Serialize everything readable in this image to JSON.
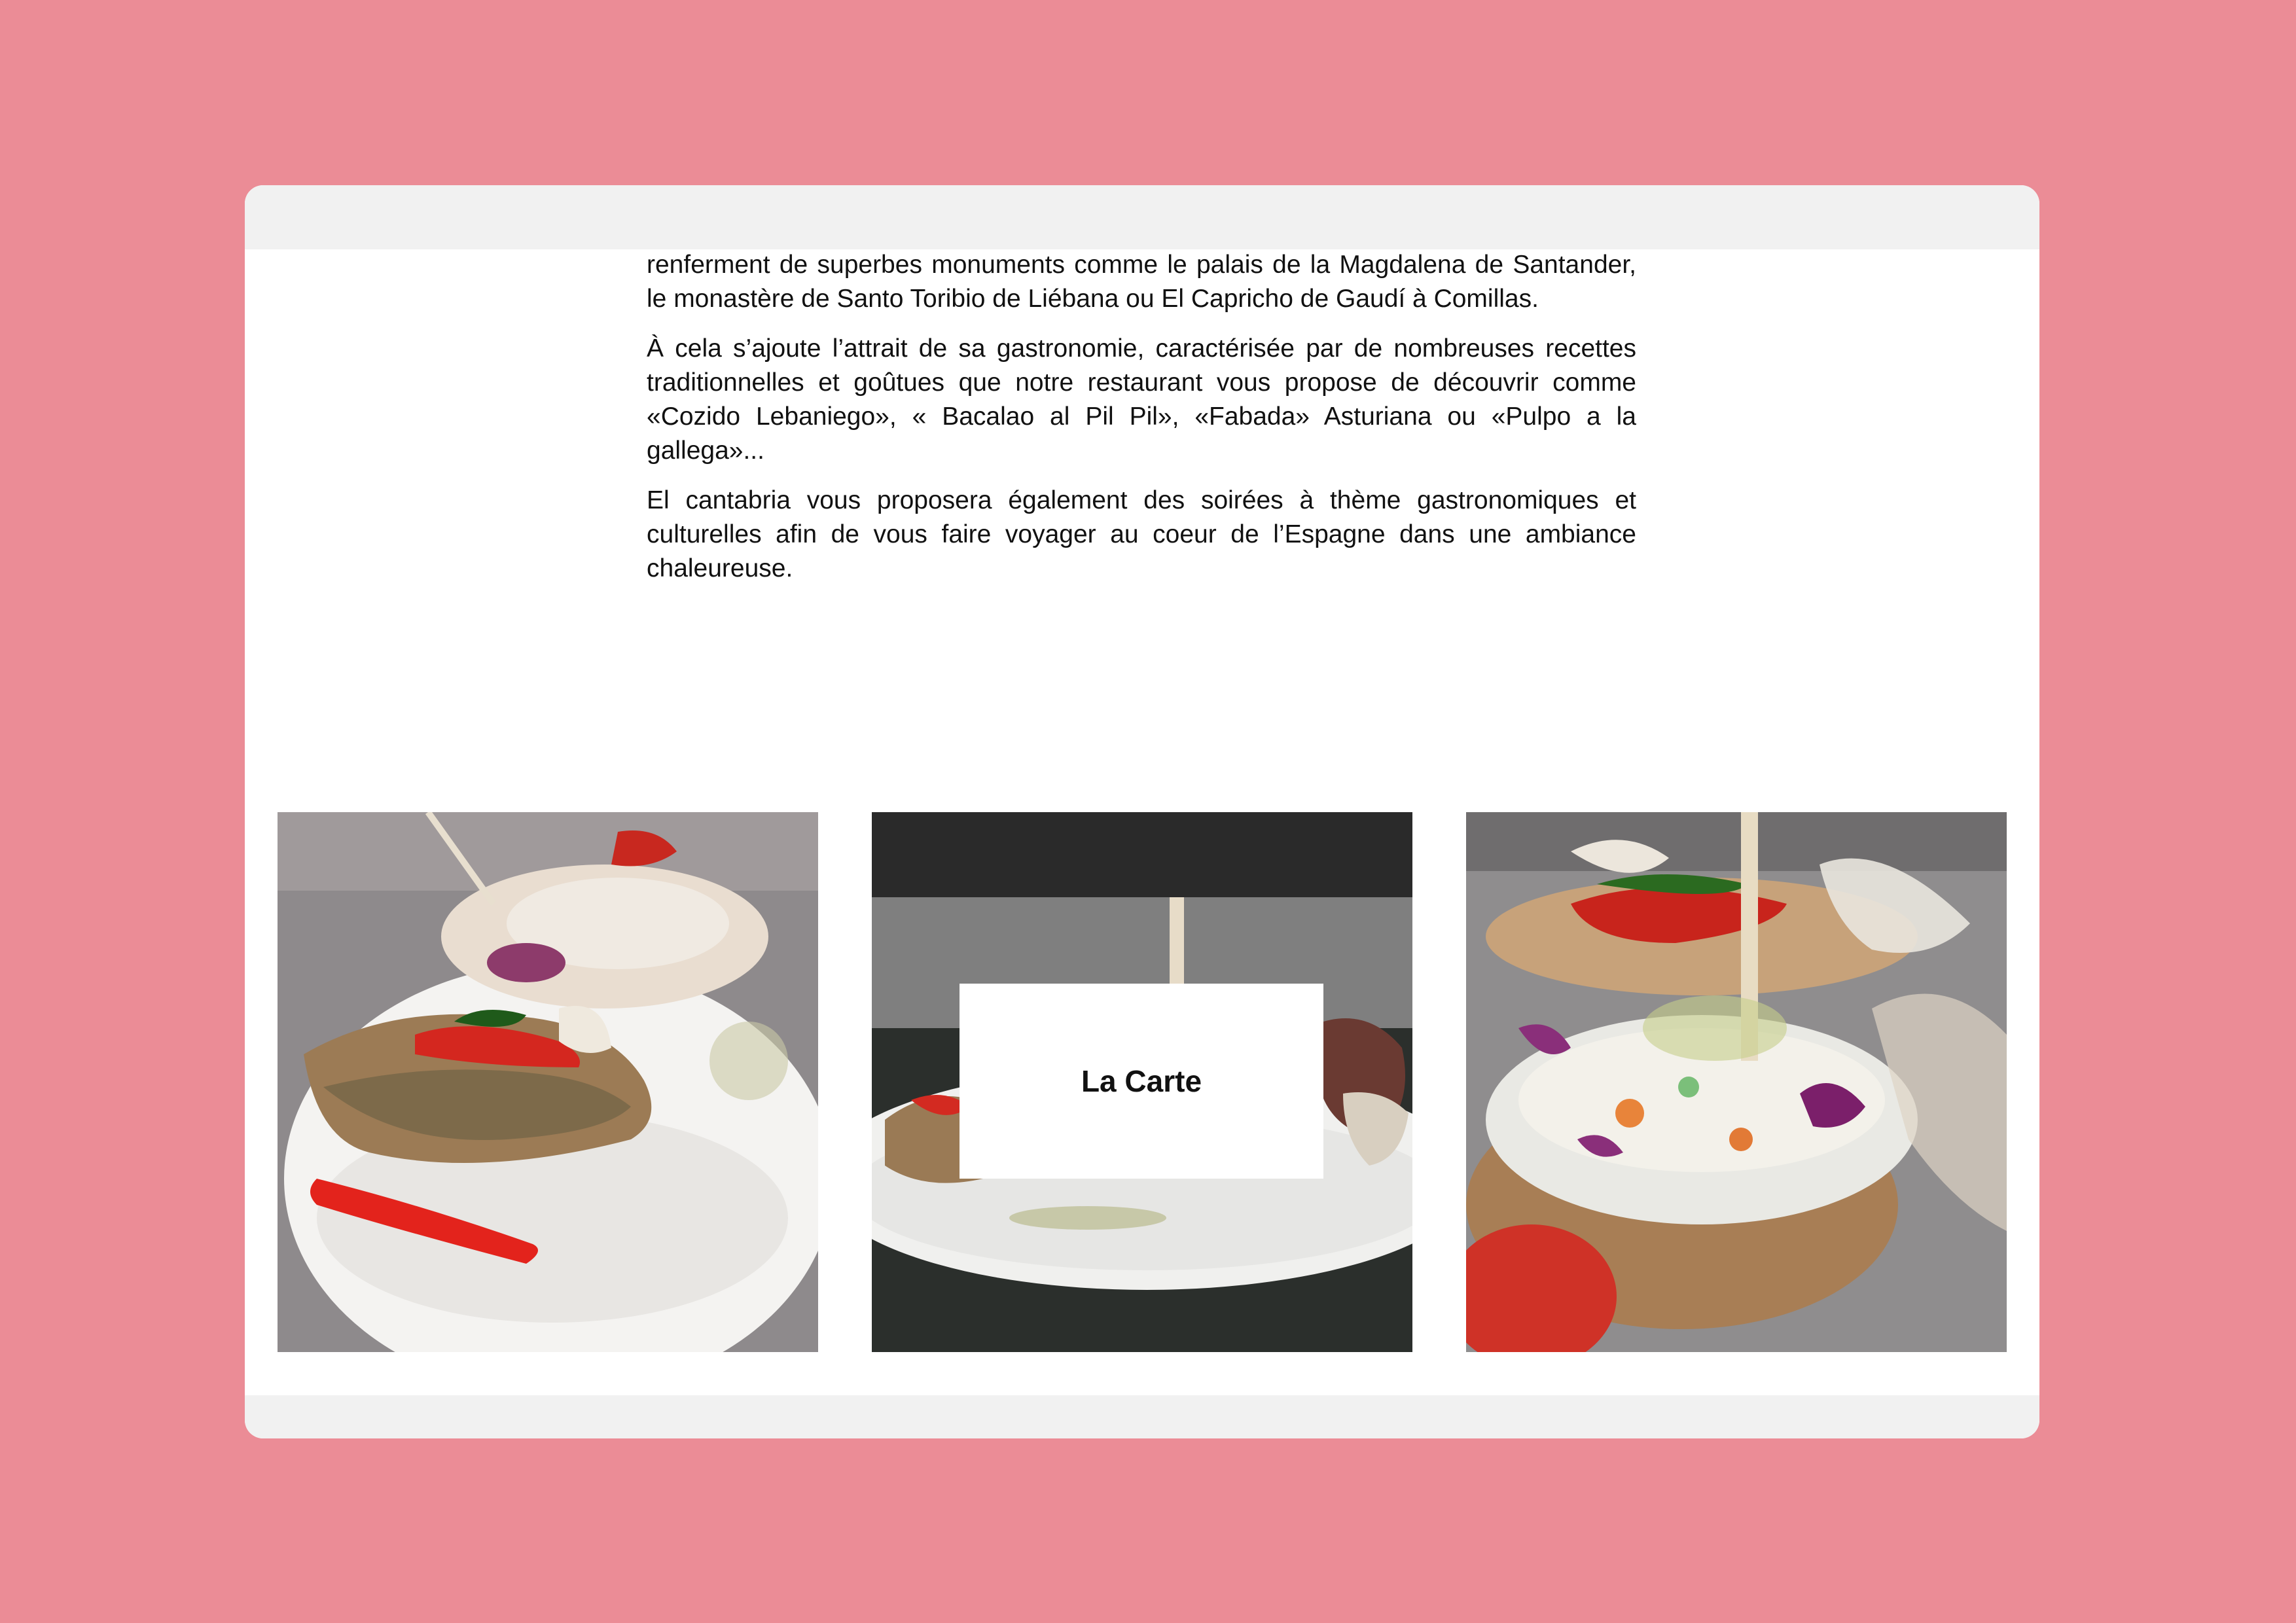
{
  "content": {
    "paragraphs": [
      "renferment de superbes monuments comme le palais de la Magdalena de Santander, le monastère de Santo Toribio de Liébana ou El Capricho de Gaudí à Comillas.",
      "À cela s’ajoute l’attrait de sa gastronomie, caractérisée par de nombreuses recettes traditionnelles et goûtues que notre restaurant vous propose de découvrir comme «Cozido Lebaniego», « Bacalao al Pil Pil», «Fabada» Asturiana ou «Pulpo a la gallega»...",
      "El cantabria vous proposera également des soirées à thème gastronomiques et culturelles afin de vous faire voyager au coeur de l’Espagne dans une ambiance chaleureuse."
    ]
  },
  "gallery": {
    "carte_label": "La Carte"
  },
  "colors": {
    "page_background": "#eb8c96",
    "window_background": "#ffffff",
    "window_bars": "#f1f1f1"
  }
}
